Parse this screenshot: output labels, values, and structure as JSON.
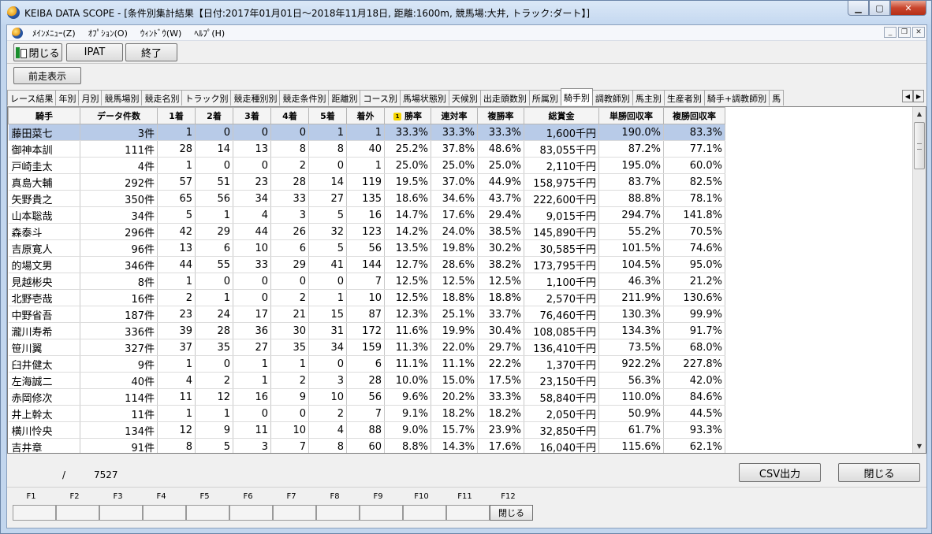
{
  "window": {
    "title": "KEIBA DATA SCOPE - [条件別集計結果【日付:2017年01月01日～2018年11月18日, 距離:1600m, 競馬場:大井, トラック:ダート】]",
    "btn_min": "▁",
    "btn_max": "▢",
    "btn_close": "✕"
  },
  "menu": {
    "items": [
      "ﾒｲﾝﾒﾆｭｰ(Z)",
      "ｵﾌﾟｼｮﾝ(O)",
      "ｳｨﾝﾄﾞｳ(W)",
      "ﾍﾙﾌﾟ(H)"
    ],
    "mdi_min": "_",
    "mdi_restore": "❐",
    "mdi_close": "✕"
  },
  "toolbar": {
    "close_label": "閉じる",
    "ipat_label": "IPAT",
    "exit_label": "終了",
    "prev_label": "前走表示"
  },
  "tabs": [
    "レース結果",
    "年別",
    "月別",
    "競馬場別",
    "競走名別",
    "トラック別",
    "競走種別別",
    "競走条件別",
    "距離別",
    "コース別",
    "馬場状態別",
    "天候別",
    "出走頭数別",
    "所属別",
    "騎手別",
    "調教師別",
    "馬主別",
    "生産者別",
    "騎手+調教師別",
    "馬"
  ],
  "active_tab": 14,
  "tab_scroll": {
    "left": "◀",
    "right": "▶"
  },
  "table": {
    "headers": [
      "騎手",
      "データ件数",
      "1着",
      "2着",
      "3着",
      "4着",
      "5着",
      "着外",
      "勝率",
      "連対率",
      "複勝率",
      "総賞金",
      "単勝回収率",
      "複勝回収率"
    ],
    "sort_badge": "1",
    "rows": [
      [
        "藤田菜七",
        "3件",
        "1",
        "0",
        "0",
        "0",
        "1",
        "1",
        "33.3%",
        "33.3%",
        "33.3%",
        "1,600千円",
        "190.0%",
        "83.3%"
      ],
      [
        "御神本訓",
        "111件",
        "28",
        "14",
        "13",
        "8",
        "8",
        "40",
        "25.2%",
        "37.8%",
        "48.6%",
        "83,055千円",
        "87.2%",
        "77.1%"
      ],
      [
        "戸崎圭太",
        "4件",
        "1",
        "0",
        "0",
        "2",
        "0",
        "1",
        "25.0%",
        "25.0%",
        "25.0%",
        "2,110千円",
        "195.0%",
        "60.0%"
      ],
      [
        "真島大輔",
        "292件",
        "57",
        "51",
        "23",
        "28",
        "14",
        "119",
        "19.5%",
        "37.0%",
        "44.9%",
        "158,975千円",
        "83.7%",
        "82.5%"
      ],
      [
        "矢野貴之",
        "350件",
        "65",
        "56",
        "34",
        "33",
        "27",
        "135",
        "18.6%",
        "34.6%",
        "43.7%",
        "222,600千円",
        "88.8%",
        "78.1%"
      ],
      [
        "山本聡哉",
        "34件",
        "5",
        "1",
        "4",
        "3",
        "5",
        "16",
        "14.7%",
        "17.6%",
        "29.4%",
        "9,015千円",
        "294.7%",
        "141.8%"
      ],
      [
        "森泰斗",
        "296件",
        "42",
        "29",
        "44",
        "26",
        "32",
        "123",
        "14.2%",
        "24.0%",
        "38.5%",
        "145,890千円",
        "55.2%",
        "70.5%"
      ],
      [
        "吉原寛人",
        "96件",
        "13",
        "6",
        "10",
        "6",
        "5",
        "56",
        "13.5%",
        "19.8%",
        "30.2%",
        "30,585千円",
        "101.5%",
        "74.6%"
      ],
      [
        "的場文男",
        "346件",
        "44",
        "55",
        "33",
        "29",
        "41",
        "144",
        "12.7%",
        "28.6%",
        "38.2%",
        "173,795千円",
        "104.5%",
        "95.0%"
      ],
      [
        "見越彬央",
        "8件",
        "1",
        "0",
        "0",
        "0",
        "0",
        "7",
        "12.5%",
        "12.5%",
        "12.5%",
        "1,100千円",
        "46.3%",
        "21.2%"
      ],
      [
        "北野壱哉",
        "16件",
        "2",
        "1",
        "0",
        "2",
        "1",
        "10",
        "12.5%",
        "18.8%",
        "18.8%",
        "2,570千円",
        "211.9%",
        "130.6%"
      ],
      [
        "中野省吾",
        "187件",
        "23",
        "24",
        "17",
        "21",
        "15",
        "87",
        "12.3%",
        "25.1%",
        "33.7%",
        "76,460千円",
        "130.3%",
        "99.9%"
      ],
      [
        "瀧川寿希",
        "336件",
        "39",
        "28",
        "36",
        "30",
        "31",
        "172",
        "11.6%",
        "19.9%",
        "30.4%",
        "108,085千円",
        "134.3%",
        "91.7%"
      ],
      [
        "笹川翼",
        "327件",
        "37",
        "35",
        "27",
        "35",
        "34",
        "159",
        "11.3%",
        "22.0%",
        "29.7%",
        "136,410千円",
        "73.5%",
        "68.0%"
      ],
      [
        "臼井健太",
        "9件",
        "1",
        "0",
        "1",
        "1",
        "0",
        "6",
        "11.1%",
        "11.1%",
        "22.2%",
        "1,370千円",
        "922.2%",
        "227.8%"
      ],
      [
        "左海誠二",
        "40件",
        "4",
        "2",
        "1",
        "2",
        "3",
        "28",
        "10.0%",
        "15.0%",
        "17.5%",
        "23,150千円",
        "56.3%",
        "42.0%"
      ],
      [
        "赤岡修次",
        "114件",
        "11",
        "12",
        "16",
        "9",
        "10",
        "56",
        "9.6%",
        "20.2%",
        "33.3%",
        "58,840千円",
        "110.0%",
        "84.6%"
      ],
      [
        "井上幹太",
        "11件",
        "1",
        "1",
        "0",
        "0",
        "2",
        "7",
        "9.1%",
        "18.2%",
        "18.2%",
        "2,050千円",
        "50.9%",
        "44.5%"
      ],
      [
        "横川怜央",
        "134件",
        "12",
        "9",
        "11",
        "10",
        "4",
        "88",
        "9.0%",
        "15.7%",
        "23.9%",
        "32,850千円",
        "61.7%",
        "93.3%"
      ],
      [
        "吉井章",
        "91件",
        "8",
        "5",
        "3",
        "7",
        "8",
        "60",
        "8.8%",
        "14.3%",
        "17.6%",
        "16,040千円",
        "115.6%",
        "62.1%"
      ]
    ]
  },
  "scroll": {
    "up": "▲",
    "down": "▼"
  },
  "status": {
    "separator": "/",
    "total": "7527",
    "csv_label": "CSV出力",
    "close_label": "閉じる"
  },
  "fkeys": {
    "labels": [
      "F1",
      "F2",
      "F3",
      "F4",
      "F5",
      "F6",
      "F7",
      "F8",
      "F9",
      "F10",
      "F11",
      "F12"
    ],
    "f12_button": "閉じる"
  }
}
